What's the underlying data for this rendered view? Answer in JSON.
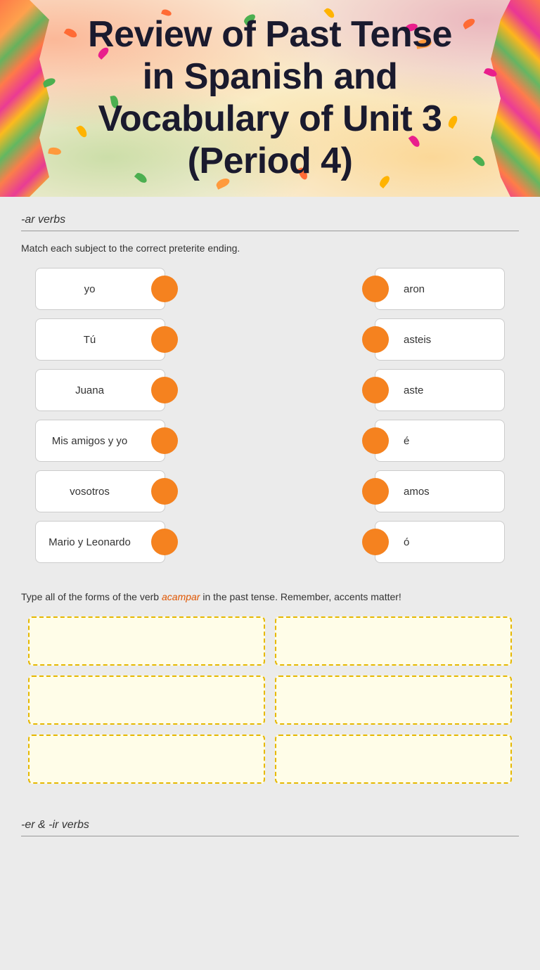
{
  "header": {
    "title_line1": "Review of Past Tense",
    "title_line2": "in Spanish and",
    "title_line3": "Vocabulary of Unit 3",
    "title_line4": "(Period 4)"
  },
  "ar_section": {
    "heading": "-ar verbs",
    "instruction": "Match each subject to the correct preterite ending.",
    "left_items": [
      "yo",
      "Tú",
      "Juana",
      "Mis amigos y yo",
      "vosotros",
      "Mario y Leonardo"
    ],
    "right_items": [
      "aron",
      "asteis",
      "aste",
      "é",
      "amos",
      "ó"
    ]
  },
  "conjugation_section": {
    "instruction_prefix": "Type all of the forms of the verb ",
    "verb": "acampar",
    "instruction_suffix": " in the past tense. Remember, accents matter!",
    "inputs": [
      "",
      "",
      "",
      "",
      "",
      ""
    ]
  },
  "er_ir_section": {
    "heading": "-er & -ir verbs"
  }
}
